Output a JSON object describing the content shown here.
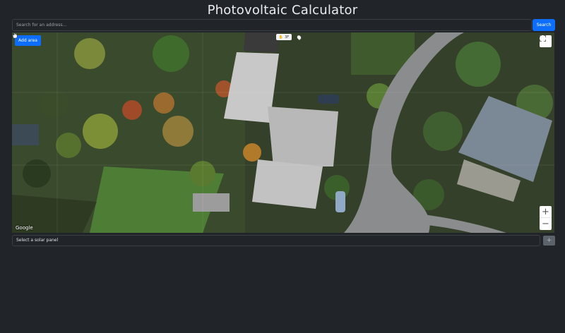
{
  "header": {
    "title": "Photovoltaic Calculator"
  },
  "search": {
    "placeholder": "Search for an address...",
    "button_label": "Search"
  },
  "map": {
    "add_area_label": "Add area",
    "compass_label": "3F",
    "attribution": "Google",
    "zoom_in_label": "+",
    "zoom_out_label": "−",
    "fullscreen_icon": "fullscreen-icon"
  },
  "solar_panel": {
    "select_label": "Select a solar panel",
    "add_label": "+"
  },
  "colors": {
    "background": "#212529",
    "accent": "#0d6efd",
    "secondary_button": "#5c636a"
  }
}
